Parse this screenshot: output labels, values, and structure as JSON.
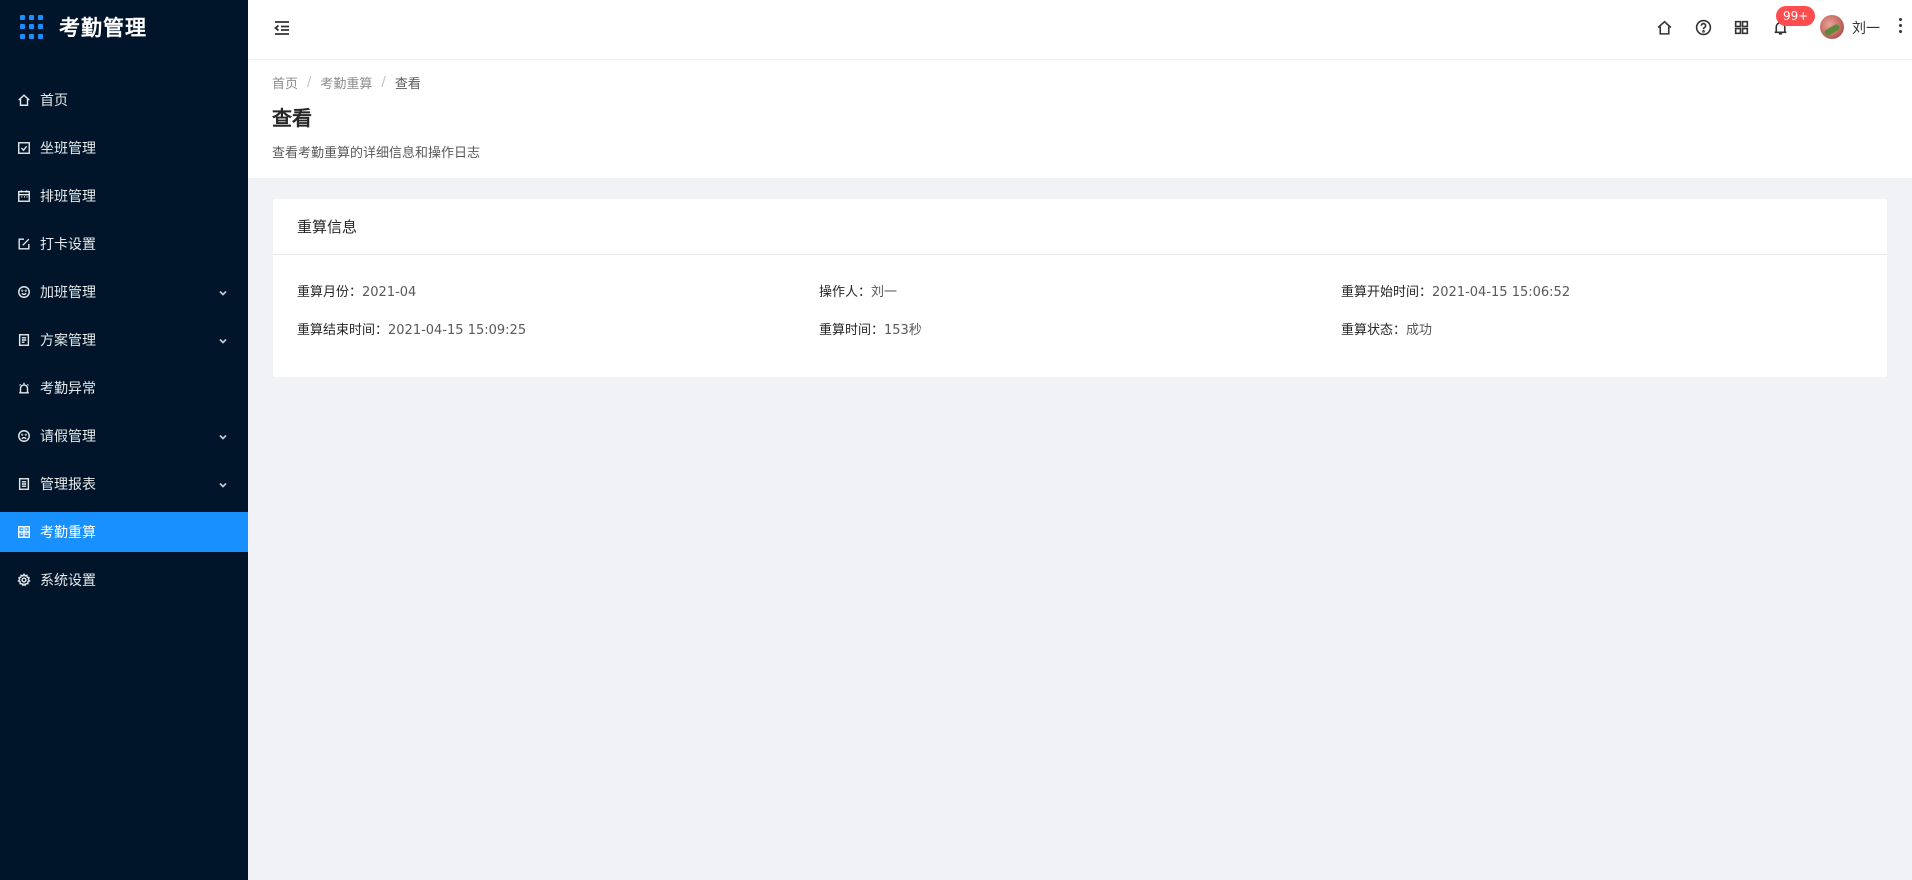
{
  "app": {
    "title": "考勤管理"
  },
  "sidebar": {
    "items": [
      {
        "label": "首页",
        "icon": "home-icon",
        "has_arrow": false,
        "active": false
      },
      {
        "label": "坐班管理",
        "icon": "checkbox-icon",
        "has_arrow": false,
        "active": false
      },
      {
        "label": "排班管理",
        "icon": "calendar-icon",
        "has_arrow": false,
        "active": false
      },
      {
        "label": "打卡设置",
        "icon": "edit-icon",
        "has_arrow": false,
        "active": false
      },
      {
        "label": "加班管理",
        "icon": "smile-icon",
        "has_arrow": true,
        "active": false
      },
      {
        "label": "方案管理",
        "icon": "file-icon",
        "has_arrow": true,
        "active": false
      },
      {
        "label": "考勤异常",
        "icon": "alarm-icon",
        "has_arrow": false,
        "active": false
      },
      {
        "label": "请假管理",
        "icon": "frown-icon",
        "has_arrow": true,
        "active": false
      },
      {
        "label": "管理报表",
        "icon": "report-icon",
        "has_arrow": true,
        "active": false
      },
      {
        "label": "考勤重算",
        "icon": "calculator-icon",
        "has_arrow": false,
        "active": true
      },
      {
        "label": "系统设置",
        "icon": "settings-icon",
        "has_arrow": false,
        "active": false
      }
    ]
  },
  "header": {
    "notification_badge": "99+",
    "username": "刘一"
  },
  "breadcrumb": {
    "items": [
      "首页",
      "考勤重算"
    ],
    "current": "查看"
  },
  "page": {
    "title": "查看",
    "description": "查看考勤重算的详细信息和操作日志"
  },
  "card": {
    "title": "重算信息",
    "rows": [
      [
        {
          "label": "重算月份：",
          "value": "2021-04"
        },
        {
          "label": "操作人：",
          "value": "刘一"
        },
        {
          "label": "重算开始时间：",
          "value": "2021-04-15 15:06:52"
        }
      ],
      [
        {
          "label": "重算结束时间：",
          "value": "2021-04-15 15:09:25"
        },
        {
          "label": "重算时间：",
          "value": "153秒"
        },
        {
          "label": "重算状态：",
          "value": "成功"
        }
      ]
    ]
  },
  "colors": {
    "sidebar_bg": "#001529",
    "accent": "#1890ff",
    "badge": "#ff4d4f"
  }
}
